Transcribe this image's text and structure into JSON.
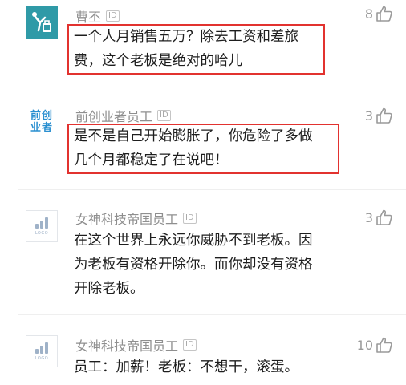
{
  "id_label": "ID",
  "comments": [
    {
      "user": "曹丕",
      "likes": "8",
      "lines": [
        "一个人月销售五万？除去工资和差旅",
        "费，这个老板是绝对的哈儿"
      ],
      "avatar_icon": "figure-icon"
    },
    {
      "user": "前创业者员工",
      "likes": "3",
      "avatar_lines": [
        "前创",
        "业者"
      ],
      "lines": [
        "是不是自己开始膨胀了，你危险了多做",
        "几个月都稳定了在说吧！"
      ]
    },
    {
      "user": "女神科技帝国员工",
      "likes": "3",
      "avatar_logo": "LOGO",
      "lines": [
        "在这个世界上永远你威胁不到老板。因",
        "为老板有资格开除你。而你却没有资格",
        "开除老板。"
      ]
    },
    {
      "user": "女神科技帝国员工",
      "likes": "10",
      "avatar_logo": "LOGO",
      "lines": [
        "员工：加薪！老板：不想干，滚蛋。"
      ]
    }
  ],
  "colors": {
    "highlight": "#e2322f",
    "avatar_teal": "#2f9aa7",
    "avatar_blue_text": "#2a8fd0"
  }
}
